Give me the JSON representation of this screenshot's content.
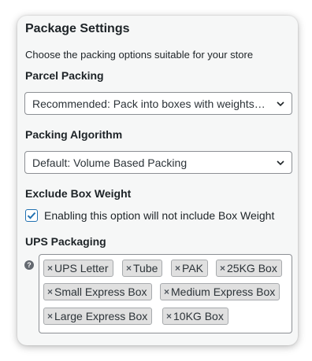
{
  "panel": {
    "title": "Package Settings",
    "description": "Choose the packing options suitable for your store"
  },
  "parcel_packing": {
    "label": "Parcel Packing",
    "selected": "Recommended: Pack into boxes with weights and dimensions"
  },
  "packing_algorithm": {
    "label": "Packing Algorithm",
    "selected": "Default: Volume Based Packing"
  },
  "exclude_box_weight": {
    "label": "Exclude Box Weight",
    "checkbox_label": "Enabling this option will not include Box Weight",
    "checked": true
  },
  "ups_packaging": {
    "label": "UPS Packaging",
    "help_icon": "help-icon",
    "remove_symbol": "×",
    "tags": [
      "UPS Letter",
      "Tube",
      "PAK",
      "25KG Box",
      "Small Express Box",
      "Medium Express Box",
      "Large Express Box",
      "10KG Box"
    ]
  },
  "colors": {
    "accent": "#2271b1",
    "tag_bg": "#e0e0e0",
    "panel_bg": "#f6f7f7"
  }
}
